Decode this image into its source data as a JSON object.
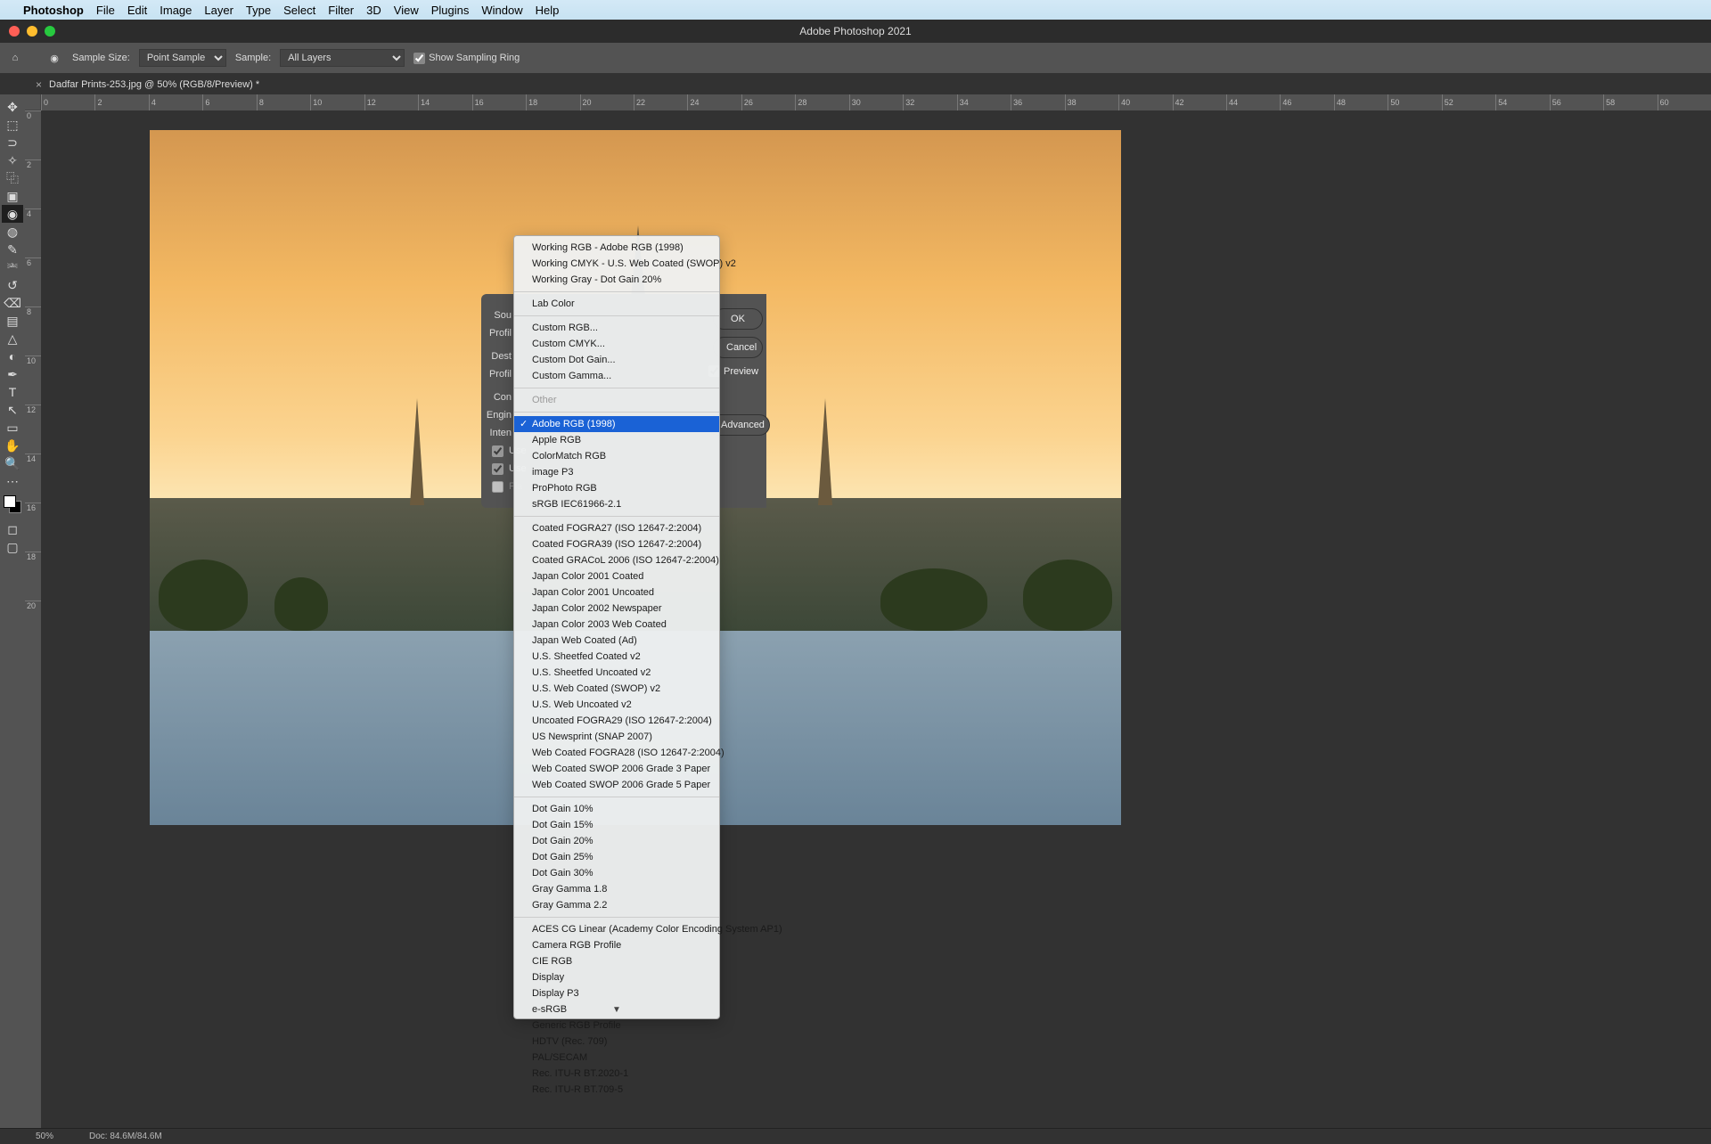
{
  "menubar": {
    "app": "Photoshop",
    "items": [
      "File",
      "Edit",
      "Image",
      "Layer",
      "Type",
      "Select",
      "Filter",
      "3D",
      "View",
      "Plugins",
      "Window",
      "Help"
    ]
  },
  "window_title": "Adobe Photoshop 2021",
  "optionsbar": {
    "sample_size_label": "Sample Size:",
    "sample_size_value": "Point Sample",
    "sample_label": "Sample:",
    "sample_value": "All Layers",
    "show_sampling_ring": "Show Sampling Ring"
  },
  "document_tab": "Dadfar Prints-253.jpg @ 50% (RGB/8/Preview) *",
  "ruler_h": [
    "0",
    "2",
    "4",
    "6",
    "8",
    "10",
    "12",
    "14",
    "16",
    "18",
    "20",
    "22",
    "24",
    "26",
    "28",
    "30",
    "32",
    "34",
    "36",
    "38",
    "40",
    "42",
    "44",
    "46",
    "48",
    "50",
    "52",
    "54",
    "56",
    "58",
    "60"
  ],
  "ruler_v": [
    "0",
    "2",
    "4",
    "6",
    "8",
    "10",
    "12",
    "14",
    "16",
    "18",
    "20"
  ],
  "dialog": {
    "source_space_label": "Sou",
    "profile_label1": "Profil",
    "destination_space_label": "Dest",
    "profile_label2": "Profil",
    "conversion_label": "Con",
    "engine_label": "Engin",
    "intent_label": "Inten",
    "use_black_point": "Use",
    "use_dither": "Use",
    "flatten": "Fla",
    "ok": "OK",
    "cancel": "Cancel",
    "preview": "Preview",
    "advanced": "Advanced"
  },
  "popup": {
    "group_working": [
      "Working RGB - Adobe RGB (1998)",
      "Working CMYK - U.S. Web Coated (SWOP) v2",
      "Working Gray - Dot Gain 20%"
    ],
    "lab": "Lab Color",
    "group_custom": [
      "Custom RGB...",
      "Custom CMYK...",
      "Custom Dot Gain...",
      "Custom Gamma..."
    ],
    "other": "Other",
    "selected": "Adobe RGB (1998)",
    "group_rgb": [
      "Apple RGB",
      "ColorMatch RGB",
      "image P3",
      "ProPhoto RGB",
      "sRGB IEC61966-2.1"
    ],
    "group_cmyk": [
      "Coated FOGRA27 (ISO 12647-2:2004)",
      "Coated FOGRA39 (ISO 12647-2:2004)",
      "Coated GRACoL 2006 (ISO 12647-2:2004)",
      "Japan Color 2001 Coated",
      "Japan Color 2001 Uncoated",
      "Japan Color 2002 Newspaper",
      "Japan Color 2003 Web Coated",
      "Japan Web Coated (Ad)",
      "U.S. Sheetfed Coated v2",
      "U.S. Sheetfed Uncoated v2",
      "U.S. Web Coated (SWOP) v2",
      "U.S. Web Uncoated v2",
      "Uncoated FOGRA29 (ISO 12647-2:2004)",
      "US Newsprint (SNAP 2007)",
      "Web Coated FOGRA28 (ISO 12647-2:2004)",
      "Web Coated SWOP 2006 Grade 3 Paper",
      "Web Coated SWOP 2006 Grade 5 Paper"
    ],
    "group_gray": [
      "Dot Gain 10%",
      "Dot Gain 15%",
      "Dot Gain 20%",
      "Dot Gain 25%",
      "Dot Gain 30%",
      "Gray Gamma 1.8",
      "Gray Gamma 2.2"
    ],
    "group_device": [
      "ACES CG Linear (Academy Color Encoding System AP1)",
      "Camera RGB Profile",
      "CIE RGB",
      "Display",
      "Display P3",
      "e-sRGB",
      "Generic RGB Profile",
      "HDTV (Rec. 709)",
      "PAL/SECAM",
      "Rec. ITU-R BT.2020-1",
      "Rec. ITU-R BT.709-5"
    ]
  },
  "tools": [
    "move",
    "marquee",
    "lasso",
    "quick-select",
    "crop",
    "frame",
    "eyedropper",
    "heal",
    "brush",
    "clone",
    "history-brush",
    "eraser",
    "gradient",
    "blur",
    "dodge",
    "pen",
    "type",
    "path-select",
    "rectangle",
    "hand",
    "zoom"
  ],
  "tool_icons": [
    "✥",
    "⬚",
    "⊃",
    "✧",
    "⿻",
    "▣",
    "◉",
    "◍",
    "✎",
    "⎃",
    "↺",
    "⌫",
    "▤",
    "△",
    "◐",
    "✒",
    "T",
    "↖",
    "▭",
    "✋",
    "🔍"
  ],
  "panel_icons": [
    "nav",
    "color",
    "swatches"
  ],
  "statusbar": {
    "zoom": "50%",
    "doc": "Doc: 84.6M/84.6M"
  }
}
